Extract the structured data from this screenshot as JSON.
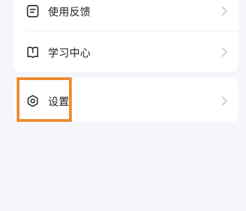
{
  "menu": {
    "items": [
      {
        "label": "使用反馈",
        "icon": "feedback-icon"
      },
      {
        "label": "学习中心",
        "icon": "book-icon"
      },
      {
        "label": "设置",
        "icon": "settings-icon"
      }
    ]
  },
  "colors": {
    "background": "#f5f6fa",
    "card": "#ffffff",
    "highlight": "#ef8a2e",
    "text": "#1f1f1f",
    "chevron": "#c4c4c4"
  }
}
